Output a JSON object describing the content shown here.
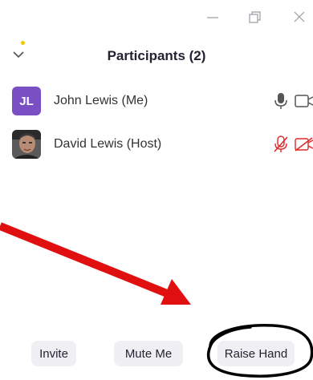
{
  "panel": {
    "title": "Participants (2)"
  },
  "participants": [
    {
      "initials": "JL",
      "name": "John Lewis (Me)",
      "avatar_color": "#7b4fc4",
      "mic": "on",
      "video": "off"
    },
    {
      "name": "David Lewis (Host)",
      "avatar": "photo",
      "mic": "muted",
      "video": "off"
    }
  ],
  "footer": {
    "invite_label": "Invite",
    "mute_label": "Mute Me",
    "raise_hand_label": "Raise Hand"
  },
  "colors": {
    "muted_red": "#e02828",
    "annotation_arrow": "#e01010",
    "annotation_circle": "#000000",
    "notification_dot": "#f2c500"
  },
  "icons": [
    "minimize-icon",
    "restore-icon",
    "close-icon",
    "chevron-down-icon",
    "microphone-icon",
    "video-camera-icon",
    "microphone-muted-icon",
    "video-camera-off-icon"
  ]
}
